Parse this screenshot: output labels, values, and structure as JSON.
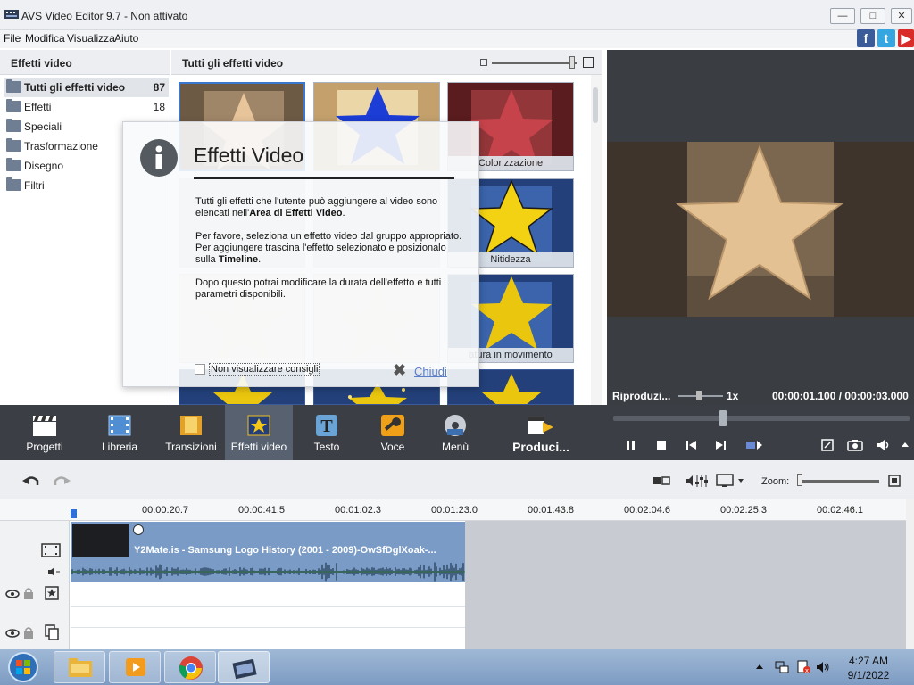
{
  "window": {
    "title": "AVS Video Editor 9.7 - Non attivato"
  },
  "menu": [
    "File",
    "Modifica",
    "Visualizza",
    "Aiuto"
  ],
  "left_panel": {
    "header": "Effetti video",
    "items": [
      {
        "label": "Tutti gli effetti video",
        "count": "87"
      },
      {
        "label": "Effetti",
        "count": "18"
      },
      {
        "label": "Speciali",
        "count": ""
      },
      {
        "label": "Trasformazione",
        "count": ""
      },
      {
        "label": "Disegno",
        "count": ""
      },
      {
        "label": "Filtri",
        "count": ""
      }
    ]
  },
  "effects_panel": {
    "header": "Tutti gli effetti video",
    "thumbnails": [
      {
        "caption": ""
      },
      {
        "caption": ""
      },
      {
        "caption": "Colorizzazione"
      },
      {
        "caption": "Nitidezza"
      },
      {
        "caption": "atura in movimento"
      }
    ]
  },
  "dialog": {
    "title": "Effetti Video",
    "p1_a": "Tutti gli effetti che l'utente può aggiungere al video sono elencati nell'",
    "p1_b": "Area di Effetti Video",
    "p1_c": ".",
    "p2_a": "Per favore, seleziona un effetto video dal gruppo appropriato. Per aggiungere trascina l'effetto selezionato e posizionalo sulla ",
    "p2_b": "Timeline",
    "p2_c": ".",
    "p3": "Dopo questo potrai modificare la durata dell'effetto e tutti i parametri disponibili.",
    "checkbox_label": "Non visualizzare consigli",
    "close_label": "Chiudi"
  },
  "preview": {
    "status": "Riproduzi...",
    "speed": "1x",
    "time": "00:00:01.100 / 00:00:03.000",
    "seek_fraction": 0.37
  },
  "toolbar": [
    {
      "label": "Progetti",
      "icon": "clapper-icon"
    },
    {
      "label": "Libreria",
      "icon": "film-icon"
    },
    {
      "label": "Transizioni",
      "icon": "transition-icon"
    },
    {
      "label": "Effetti video",
      "icon": "star-icon"
    },
    {
      "label": "Testo",
      "icon": "text-icon"
    },
    {
      "label": "Voce",
      "icon": "microphone-icon"
    },
    {
      "label": "Menù",
      "icon": "disc-icon"
    },
    {
      "label": "Produci...",
      "icon": "produce-icon"
    }
  ],
  "timeline": {
    "zoom_label": "Zoom:",
    "ticks": [
      "00:00:20.7",
      "00:00:41.5",
      "00:01:02.3",
      "00:01:23.0",
      "00:01:43.8",
      "00:02:04.6",
      "00:02:25.3",
      "00:02:46.1"
    ],
    "clip_title": "Y2Mate.is - Samsung Logo History (2001 - 2009)-OwSfDglXoak-..."
  },
  "taskbar": {
    "time": "4:27 AM",
    "date": "9/1/2022"
  },
  "colors": {
    "toolbar_bg": "#3b3f45",
    "selected_tool": "#576170",
    "clip_bg": "#7a9bc6",
    "link": "#5b7fc7"
  }
}
